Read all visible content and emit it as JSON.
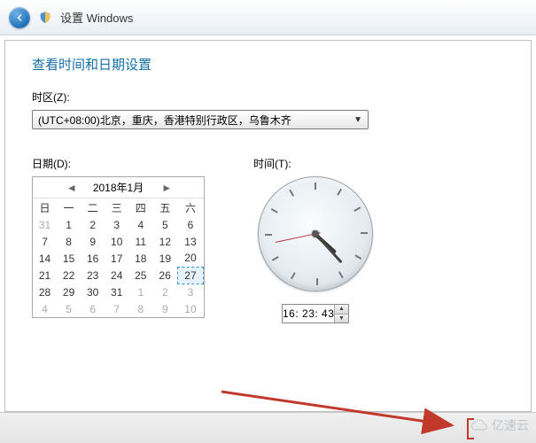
{
  "header": {
    "title": "设置 Windows"
  },
  "page": {
    "heading": "查看时间和日期设置"
  },
  "timezone": {
    "label": "时区(Z):",
    "value": "(UTC+08:00)北京，重庆，香港特别行政区，乌鲁木齐"
  },
  "date": {
    "label": "日期(D):",
    "month_title": "2018年1月",
    "weekdays": [
      "日",
      "一",
      "二",
      "三",
      "四",
      "五",
      "六"
    ],
    "grid": [
      [
        {
          "d": "31",
          "o": true
        },
        {
          "d": "1"
        },
        {
          "d": "2"
        },
        {
          "d": "3"
        },
        {
          "d": "4"
        },
        {
          "d": "5"
        },
        {
          "d": "6"
        }
      ],
      [
        {
          "d": "7"
        },
        {
          "d": "8"
        },
        {
          "d": "9"
        },
        {
          "d": "10"
        },
        {
          "d": "11"
        },
        {
          "d": "12"
        },
        {
          "d": "13"
        }
      ],
      [
        {
          "d": "14"
        },
        {
          "d": "15"
        },
        {
          "d": "16"
        },
        {
          "d": "17"
        },
        {
          "d": "18"
        },
        {
          "d": "19"
        },
        {
          "d": "20"
        }
      ],
      [
        {
          "d": "21"
        },
        {
          "d": "22"
        },
        {
          "d": "23"
        },
        {
          "d": "24"
        },
        {
          "d": "25"
        },
        {
          "d": "26"
        },
        {
          "d": "27",
          "today": true
        }
      ],
      [
        {
          "d": "28"
        },
        {
          "d": "29"
        },
        {
          "d": "30"
        },
        {
          "d": "31"
        },
        {
          "d": "1",
          "o": true
        },
        {
          "d": "2",
          "o": true
        },
        {
          "d": "3",
          "o": true
        }
      ],
      [
        {
          "d": "4",
          "o": true
        },
        {
          "d": "5",
          "o": true
        },
        {
          "d": "6",
          "o": true
        },
        {
          "d": "7",
          "o": true
        },
        {
          "d": "8",
          "o": true
        },
        {
          "d": "9",
          "o": true
        },
        {
          "d": "10",
          "o": true
        }
      ]
    ]
  },
  "time": {
    "label": "时间(T):",
    "value": "16: 23: 43"
  },
  "watermark": {
    "text": "亿速云"
  }
}
